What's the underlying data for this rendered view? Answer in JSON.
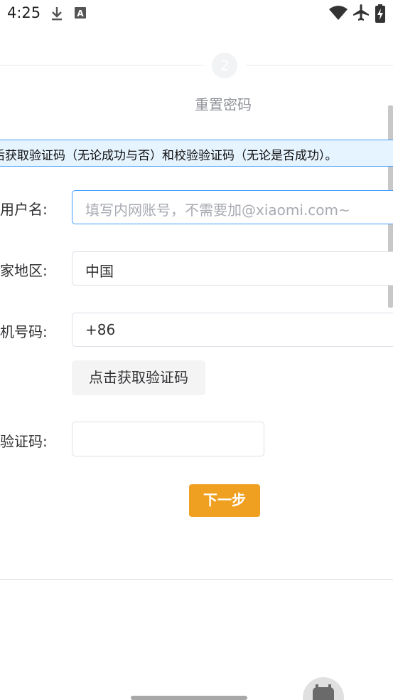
{
  "status_bar": {
    "time": "4:25",
    "icons": [
      "download-icon",
      "keyboard-a-icon",
      "wifi-icon",
      "airplane-icon",
      "battery-charging-icon"
    ]
  },
  "steps": {
    "current_number": "2",
    "current_title": "重置密码"
  },
  "banner": {
    "text": "后获取验证码（无论成功与否）和校验验证码（无论是否成功）。"
  },
  "form": {
    "username": {
      "label": "用户名:",
      "placeholder": "填写内网账号，不需要加@xiaomi.com~",
      "value": ""
    },
    "region": {
      "label": "家地区:",
      "value": "中国"
    },
    "phone": {
      "label": "机号码:",
      "value": "+86"
    },
    "get_code_button": "点击获取验证码",
    "code": {
      "label": "验证码:",
      "value": ""
    },
    "next_button": "下一步"
  },
  "colors": {
    "accent_blue": "#409eff",
    "banner_bg": "#e6f4ff",
    "next_button": "#f0a020"
  }
}
